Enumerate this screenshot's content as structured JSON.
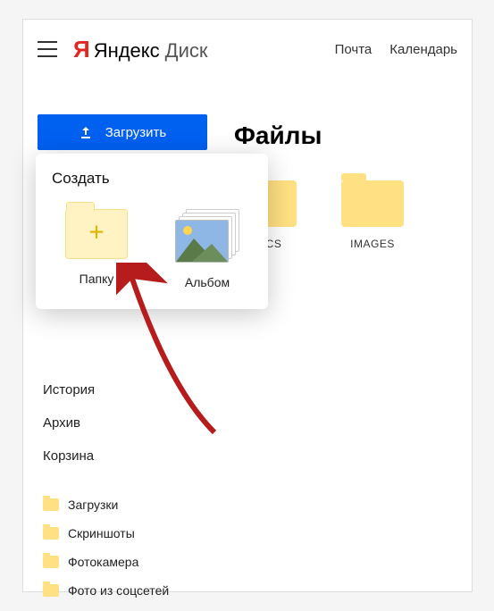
{
  "header": {
    "logo_brand": "Яндекс",
    "logo_product": "Диск",
    "links": {
      "mail": "Почта",
      "calendar": "Календарь"
    }
  },
  "sidebar": {
    "upload_label": "Загрузить",
    "nav": {
      "history": "История",
      "archive": "Архив",
      "trash": "Корзина"
    },
    "folders": {
      "downloads": "Загрузки",
      "screenshots": "Скриншоты",
      "camera": "Фотокамера",
      "social": "Фото из соцсетей"
    }
  },
  "main": {
    "title": "Файлы",
    "items": {
      "docs": "DOCS",
      "images": "IMAGES"
    }
  },
  "popup": {
    "title": "Создать",
    "folder": "Папку",
    "album": "Альбом"
  }
}
